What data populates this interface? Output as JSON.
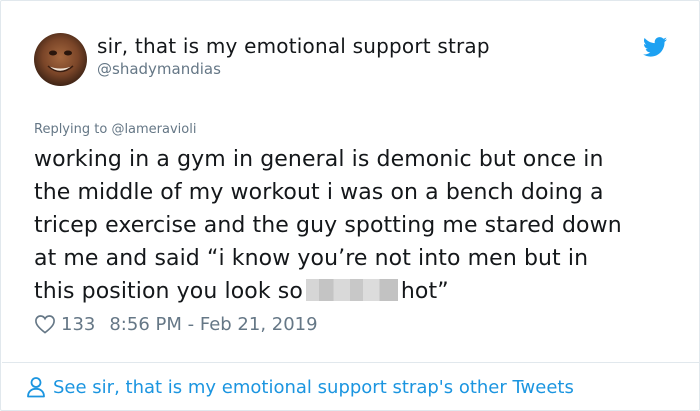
{
  "user": {
    "display_name": "sir, that is my emotional support strap",
    "handle": "@shadymandias"
  },
  "reply": {
    "prefix": "Replying to",
    "target": "@lameravioli"
  },
  "tweet": {
    "lines": [
      "working in a gym in general is demonic but once in",
      "the middle of my workout i was on a bench doing a",
      "tricep exercise and the guy spotting me stared down",
      "at me and said “i know you’re not into men but in"
    ],
    "last_line_before": "this position you look so",
    "last_line_after": "hot”"
  },
  "meta": {
    "likes": "133",
    "timestamp": "8:56 PM - Feb 21, 2019"
  },
  "footer": {
    "other_tweets_label": "See sir, that is my emotional support strap's other Tweets"
  },
  "colors": {
    "text": "#14171a",
    "secondary": "#657786",
    "link": "#1b95e0",
    "twitter_blue": "#1da1f2",
    "border": "#e1e8ed"
  },
  "icons": {
    "brand": "twitter-bird-icon",
    "like": "heart-icon",
    "profile": "person-icon"
  }
}
